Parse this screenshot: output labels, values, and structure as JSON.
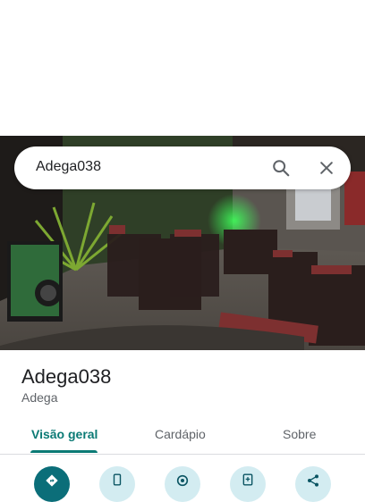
{
  "search": {
    "query": "Adega038"
  },
  "place": {
    "name": "Adega038",
    "category": "Adega"
  },
  "tabs": [
    {
      "label": "Visão geral",
      "selected": true
    },
    {
      "label": "Cardápio"
    },
    {
      "label": "Sobre"
    }
  ],
  "actions": [
    {
      "icon": "directions-icon"
    },
    {
      "icon": "phone-icon"
    },
    {
      "icon": "location-icon"
    },
    {
      "icon": "save-icon"
    },
    {
      "icon": "share-icon"
    }
  ],
  "colors": {
    "accent": "#0b7a75",
    "primary_action": "#0b6e79",
    "tonal_action": "#d3ecf1"
  }
}
